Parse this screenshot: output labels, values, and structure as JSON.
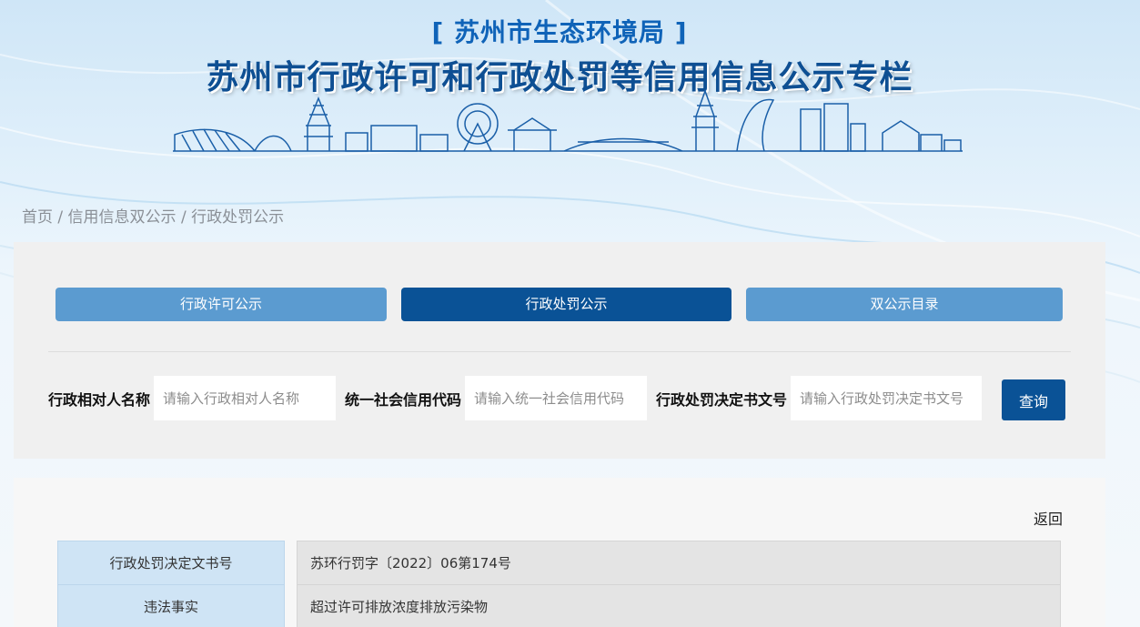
{
  "header": {
    "agency": "[ 苏州市生态环境局 ]",
    "title": "苏州市行政许可和行政处罚等信用信息公示专栏"
  },
  "breadcrumb": {
    "home": "首页",
    "separator": " / ",
    "section": "信用信息双公示",
    "current": "行政处罚公示"
  },
  "tabs": [
    {
      "label": "行政许可公示",
      "active": false
    },
    {
      "label": "行政处罚公示",
      "active": true
    },
    {
      "label": "双公示目录",
      "active": false
    }
  ],
  "search": {
    "name_label": "行政相对人名称",
    "name_placeholder": "请输入行政相对人名称",
    "code_label": "统一社会信用代码",
    "code_placeholder": "请输入统一社会信用代码",
    "doc_label": "行政处罚决定书文号",
    "doc_placeholder": "请输入行政处罚决定书文号",
    "query_label": "查询"
  },
  "detail": {
    "back_label": "返回",
    "rows": [
      {
        "label": "行政处罚决定文书号",
        "value": "苏环行罚字〔2022〕06第174号"
      },
      {
        "label": "违法事实",
        "value": "超过许可排放浓度排放污染物"
      }
    ]
  },
  "colors": {
    "primary": "#0a5296",
    "tab_inactive": "#5b9bd0",
    "title_blue": "#0e4f93"
  }
}
